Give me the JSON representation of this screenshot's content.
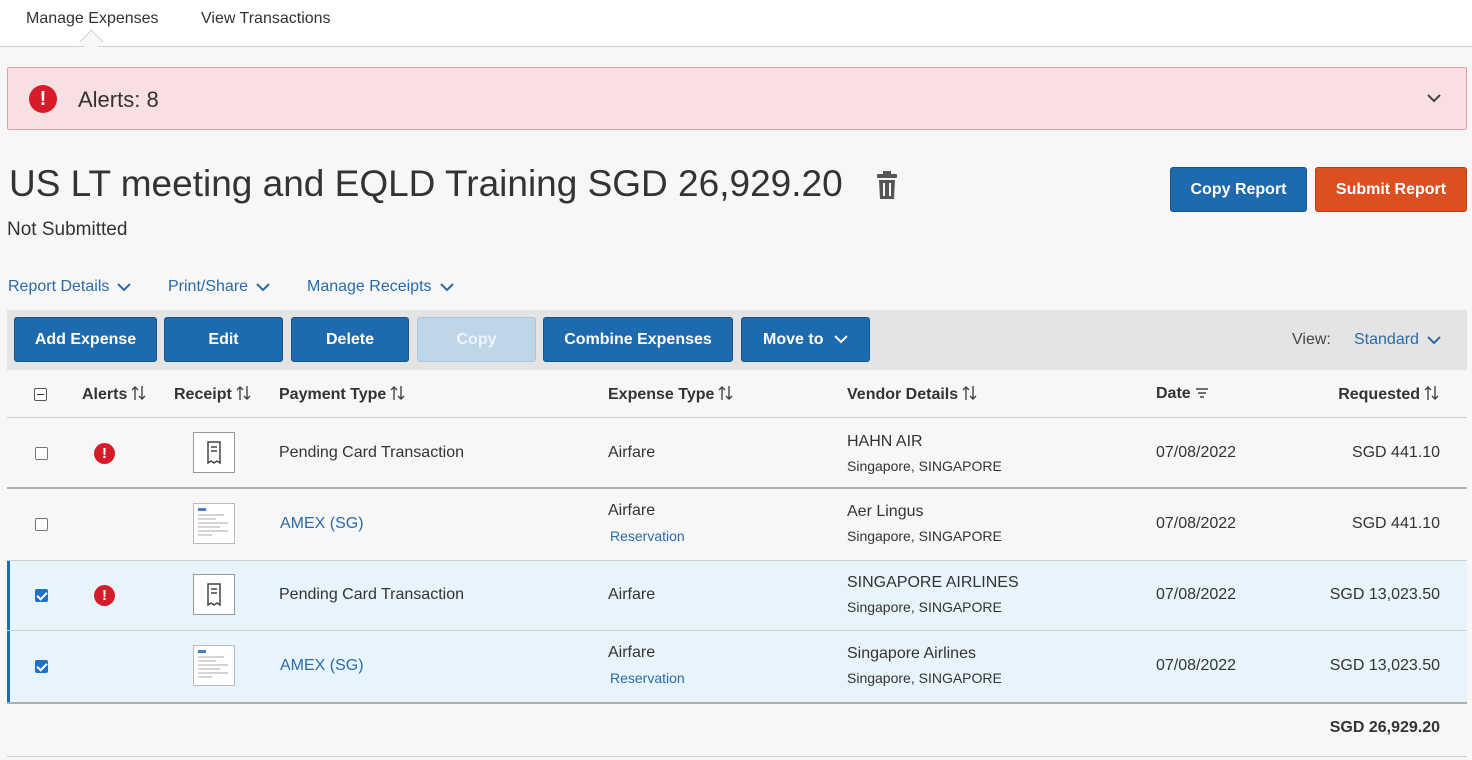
{
  "tabs": [
    {
      "label": "Manage Expenses",
      "active": true
    },
    {
      "label": "View Transactions",
      "active": false
    }
  ],
  "alerts": {
    "text": "Alerts: 8",
    "icon": "exclamation-circle-icon",
    "color": "#d71b29"
  },
  "report": {
    "title": "US LT meeting and EQLD Training SGD 26,929.20",
    "status": "Not Submitted",
    "copy_label": "Copy Report",
    "submit_label": "Submit Report"
  },
  "sub_menu": {
    "report_details": "Report Details",
    "print_share": "Print/Share",
    "manage_receipts": "Manage Receipts"
  },
  "toolbar": {
    "add_expense": "Add Expense",
    "edit": "Edit",
    "delete": "Delete",
    "copy": "Copy",
    "combine": "Combine Expenses",
    "move_to": "Move to",
    "view_label": "View:",
    "view_value": "Standard"
  },
  "columns": {
    "alerts": "Alerts",
    "receipt": "Receipt",
    "payment_type": "Payment Type",
    "expense_type": "Expense Type",
    "vendor_details": "Vendor Details",
    "date": "Date",
    "requested": "Requested"
  },
  "rows": [
    {
      "checked": false,
      "alert": true,
      "receipt": "receipt-icon",
      "payment_type": "Pending Card Transaction",
      "payment_link": false,
      "expense_type": "Airfare",
      "expense_sub": "",
      "vendor": "HAHN AIR",
      "vendor_location": "Singapore, SINGAPORE",
      "date": "07/08/2022",
      "requested": "SGD 441.10"
    },
    {
      "checked": false,
      "alert": false,
      "receipt": "receipt-thumbnail",
      "payment_type": "AMEX (SG)",
      "payment_link": true,
      "expense_type": "Airfare",
      "expense_sub": "Reservation",
      "vendor": "Aer Lingus",
      "vendor_location": "Singapore, SINGAPORE",
      "date": "07/08/2022",
      "requested": "SGD 441.10"
    },
    {
      "checked": true,
      "alert": true,
      "receipt": "receipt-icon",
      "payment_type": "Pending Card Transaction",
      "payment_link": false,
      "expense_type": "Airfare",
      "expense_sub": "",
      "vendor": "SINGAPORE AIRLINES",
      "vendor_location": "Singapore, SINGAPORE",
      "date": "07/08/2022",
      "requested": "SGD 13,023.50"
    },
    {
      "checked": true,
      "alert": false,
      "receipt": "receipt-thumbnail",
      "payment_type": "AMEX (SG)",
      "payment_link": true,
      "expense_type": "Airfare",
      "expense_sub": "Reservation",
      "vendor": "Singapore Airlines",
      "vendor_location": "Singapore, SINGAPORE",
      "date": "07/08/2022",
      "requested": "SGD 13,023.50"
    }
  ],
  "total": "SGD 26,929.20",
  "colors": {
    "primary": "#1e6aae",
    "submit": "#dd4f20",
    "link": "#2a6aa7",
    "alert_bg": "#f8dfe1"
  }
}
